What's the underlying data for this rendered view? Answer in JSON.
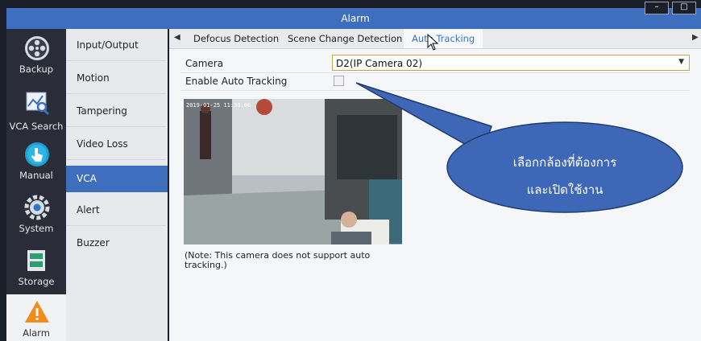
{
  "window": {
    "title": "Alarm"
  },
  "leftnav": [
    {
      "label": "Backup",
      "icon": "film-reel-icon"
    },
    {
      "label": "VCA Search",
      "icon": "chart-search-icon"
    },
    {
      "label": "Manual",
      "icon": "hand-pointer-icon"
    },
    {
      "label": "System",
      "icon": "gear-icon"
    },
    {
      "label": "Storage",
      "icon": "storage-icon"
    },
    {
      "label": "Alarm",
      "icon": "warning-icon"
    }
  ],
  "submenu": [
    "Input/Output",
    "Motion",
    "Tampering",
    "Video Loss",
    "VCA",
    "Alert",
    "Buzzer"
  ],
  "tabs": [
    "Defocus Detection",
    "Scene Change Detection",
    "Auto Tracking"
  ],
  "form": {
    "camera_label": "Camera",
    "camera_value": "D2(IP Camera 02)",
    "auto_tracking_label": "Enable Auto Tracking"
  },
  "preview": {
    "timestamp": "2019-01-25 11:38:06"
  },
  "note": "(Note: This camera does not support auto tracking.)",
  "callout": {
    "line1": "เลือกกล้องที่ต้องการ",
    "line2": "และเปิดใช้งาน"
  },
  "colors": {
    "accent": "#3d6fbe",
    "callout": "#3f67b8"
  }
}
